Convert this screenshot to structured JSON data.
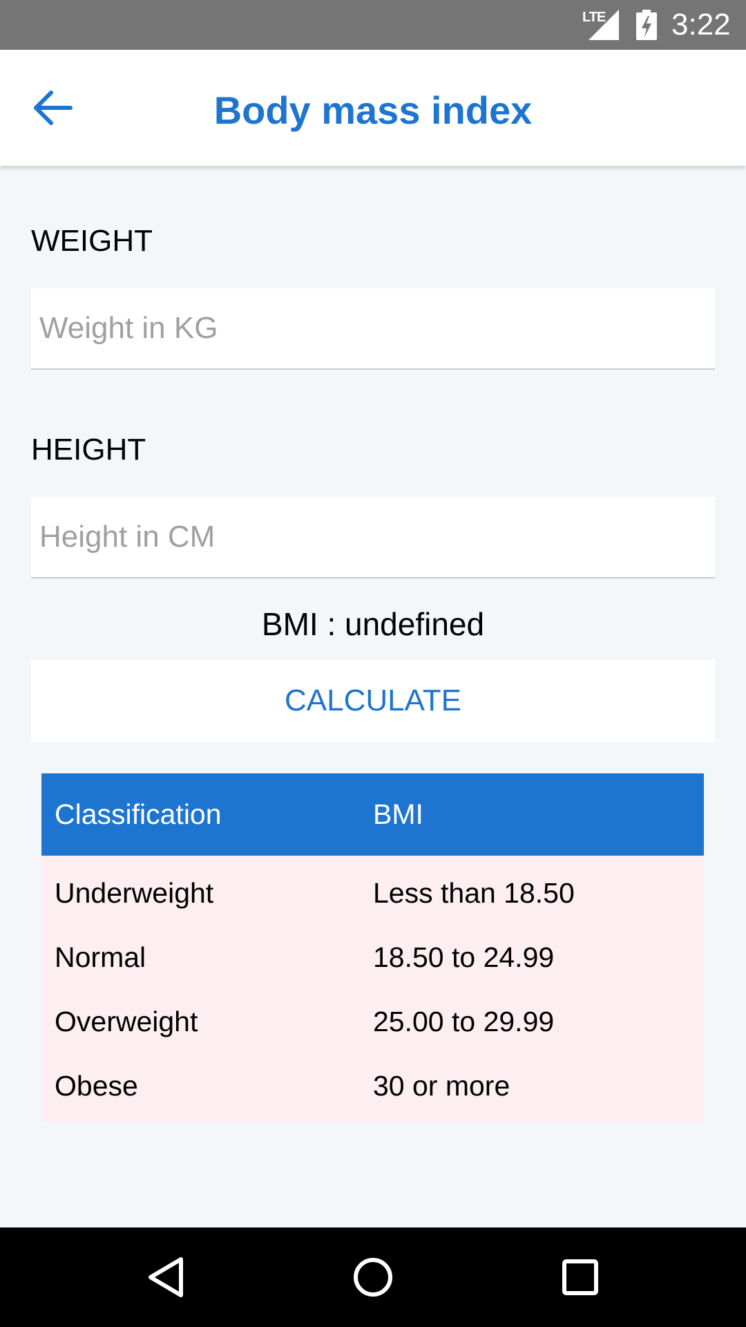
{
  "status_bar": {
    "network": "LTE",
    "time": "3:22"
  },
  "app_bar": {
    "title": "Body mass index"
  },
  "form": {
    "weight_label": "WEIGHT",
    "weight_placeholder": "Weight in KG",
    "weight_value": "",
    "height_label": "HEIGHT",
    "height_placeholder": "Height in CM",
    "height_value": "",
    "bmi_result": "BMI : undefined",
    "calculate_label": "CALCULATE"
  },
  "table": {
    "headers": [
      "Classification",
      "BMI"
    ],
    "rows": [
      [
        "Underweight",
        "Less than 18.50"
      ],
      [
        "Normal",
        "18.50 to 24.99"
      ],
      [
        "Overweight",
        "25.00 to 29.99"
      ],
      [
        "Obese",
        "30 or more"
      ]
    ]
  },
  "colors": {
    "accent": "#1d75d0",
    "background": "#f4f7fa",
    "table_body": "#fdeef2",
    "status_bar": "#757575"
  },
  "icons": {
    "back": "arrow-left-icon",
    "signal": "cell-signal-icon",
    "battery": "battery-charging-icon",
    "nav_back": "triangle-back-icon",
    "nav_home": "circle-home-icon",
    "nav_recents": "square-recents-icon"
  }
}
